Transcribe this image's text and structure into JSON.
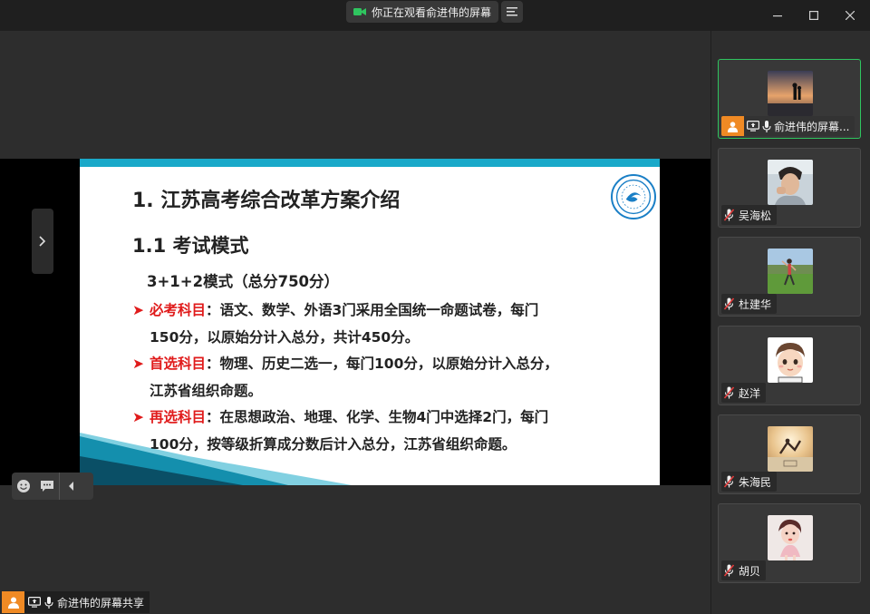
{
  "titlebar": {
    "share_status": "你正在观看俞进伟的屏幕"
  },
  "slide": {
    "title": "1. 江苏高考综合改革方案介绍",
    "subtitle": "1.1  考试模式",
    "mode": "3+1+2模式（总分750分）",
    "items": [
      {
        "key": "必考科目",
        "line1": "：语文、数学、外语3门采用全国统一命题试卷，每门",
        "line2": "150分，以原始分计入总分，共计450分。"
      },
      {
        "key": "首选科目",
        "line1": "：物理、历史二选一，每门100分，以原始分计入总分，",
        "line2": "江苏省组织命题。"
      },
      {
        "key": "再选科目",
        "line1": "：在思想政治、地理、化学、生物4门中选择2门，每门",
        "line2": "100分，按等级折算成分数后计入总分，江苏省组织命题。"
      }
    ]
  },
  "presenter": {
    "label": "俞进伟的屏幕共享"
  },
  "participants": [
    {
      "name": "俞进伟的屏幕...",
      "active": true
    },
    {
      "name": "吴海松"
    },
    {
      "name": "杜建华"
    },
    {
      "name": "赵洋"
    },
    {
      "name": "朱海民"
    },
    {
      "name": "胡贝"
    }
  ],
  "colors": {
    "accent_green": "#2fc55f",
    "slide_bar": "#1aa9c9",
    "highlight_red": "#e01b1b",
    "avatar_orange": "#f08a24"
  }
}
